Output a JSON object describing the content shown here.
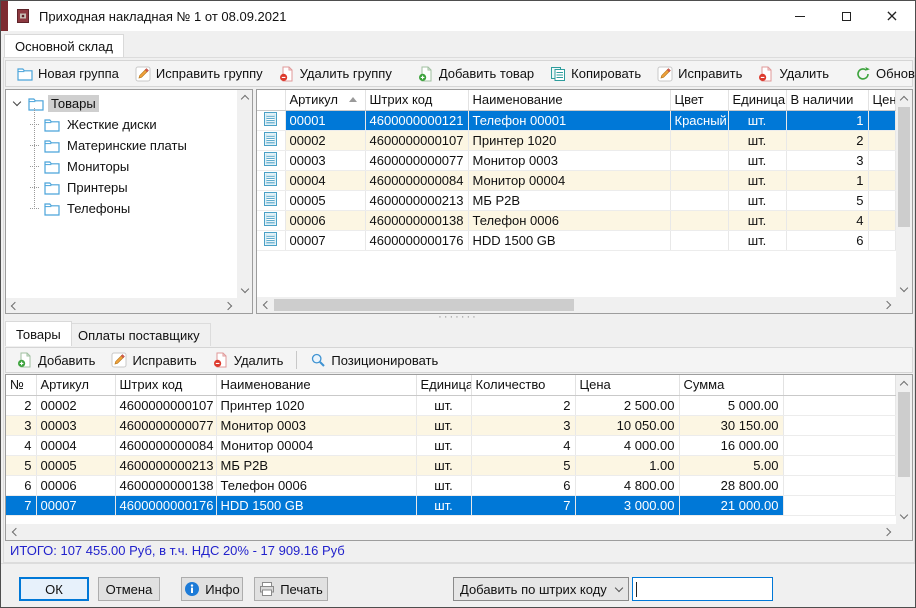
{
  "window": {
    "title": "Приходная накладная № 1 от 08.09.2021",
    "app_icon": "book-icon",
    "controls": [
      "minimize",
      "maximize",
      "close"
    ]
  },
  "main_tab": {
    "label": "Основной склад"
  },
  "toolbar_top": {
    "buttons": [
      {
        "icon": "new-group-folder-icon",
        "label": "Новая группа"
      },
      {
        "icon": "edit-pencil-icon",
        "label": "Исправить группу"
      },
      {
        "icon": "delete-page-icon",
        "label": "Удалить группу"
      },
      {
        "icon": "add-page-icon",
        "label": "Добавить товар"
      },
      {
        "icon": "copy-pages-icon",
        "label": "Копировать"
      },
      {
        "icon": "edit-pencil-icon",
        "label": "Исправить"
      },
      {
        "icon": "delete-page-icon",
        "label": "Удалить"
      },
      {
        "icon": "refresh-icon",
        "label": "Обновить"
      }
    ]
  },
  "tree": {
    "root": "Товары",
    "children": [
      "Жесткие диски",
      "Материнские платы",
      "Мониторы",
      "Принтеры",
      "Телефоны"
    ]
  },
  "products_table": {
    "columns": [
      "",
      "Артикул",
      "Штрих код",
      "Наименование",
      "Цвет",
      "Единица",
      "В наличии",
      "Цена"
    ],
    "sort": {
      "column": "Артикул",
      "direction": "asc"
    },
    "rows": [
      {
        "articul": "00001",
        "barcode": "4600000000121",
        "name": "Телефон 00001",
        "color": "Красный",
        "unit": "шт.",
        "stock": "1",
        "price": "",
        "selected": true
      },
      {
        "articul": "00002",
        "barcode": "4600000000107",
        "name": "Принтер 1020",
        "color": "",
        "unit": "шт.",
        "stock": "2",
        "price": ""
      },
      {
        "articul": "00003",
        "barcode": "4600000000077",
        "name": "Монитор 0003",
        "color": "",
        "unit": "шт.",
        "stock": "3",
        "price": ""
      },
      {
        "articul": "00004",
        "barcode": "4600000000084",
        "name": "Монитор 00004",
        "color": "",
        "unit": "шт.",
        "stock": "1",
        "price": ""
      },
      {
        "articul": "00005",
        "barcode": "4600000000213",
        "name": "МБ Р2В",
        "color": "",
        "unit": "шт.",
        "stock": "5",
        "price": ""
      },
      {
        "articul": "00006",
        "barcode": "4600000000138",
        "name": "Телефон 0006",
        "color": "",
        "unit": "шт.",
        "stock": "4",
        "price": ""
      },
      {
        "articul": "00007",
        "barcode": "4600000000176",
        "name": "HDD 1500 GB",
        "color": "",
        "unit": "шт.",
        "stock": "6",
        "price": ""
      }
    ]
  },
  "bottom_tabs": [
    {
      "label": "Товары",
      "active": true
    },
    {
      "label": "Оплаты поставщику",
      "active": false
    }
  ],
  "toolbar_bottom": {
    "buttons": [
      {
        "icon": "add-page-icon",
        "label": "Добавить"
      },
      {
        "icon": "edit-pencil-icon",
        "label": "Исправить"
      },
      {
        "icon": "delete-page-icon",
        "label": "Удалить"
      },
      {
        "icon": "search-icon",
        "label": "Позиционировать"
      }
    ]
  },
  "invoice_table": {
    "columns": [
      "№",
      "Артикул",
      "Штрих код",
      "Наименование",
      "Единица",
      "Количество",
      "Цена",
      "Сумма"
    ],
    "rows": [
      {
        "num": "2",
        "articul": "00002",
        "barcode": "4600000000107",
        "name": "Принтер 1020",
        "unit": "шт.",
        "qty": "2",
        "price": "2 500.00",
        "sum": "5 000.00"
      },
      {
        "num": "3",
        "articul": "00003",
        "barcode": "4600000000077",
        "name": "Монитор 0003",
        "unit": "шт.",
        "qty": "3",
        "price": "10 050.00",
        "sum": "30 150.00"
      },
      {
        "num": "4",
        "articul": "00004",
        "barcode": "4600000000084",
        "name": "Монитор 00004",
        "unit": "шт.",
        "qty": "4",
        "price": "4 000.00",
        "sum": "16 000.00"
      },
      {
        "num": "5",
        "articul": "00005",
        "barcode": "4600000000213",
        "name": "МБ Р2В",
        "unit": "шт.",
        "qty": "5",
        "price": "1.00",
        "sum": "5.00"
      },
      {
        "num": "6",
        "articul": "00006",
        "barcode": "4600000000138",
        "name": "Телефон 0006",
        "unit": "шт.",
        "qty": "6",
        "price": "4 800.00",
        "sum": "28 800.00"
      },
      {
        "num": "7",
        "articul": "00007",
        "barcode": "4600000000176",
        "name": "HDD 1500 GB",
        "unit": "шт.",
        "qty": "7",
        "price": "3 000.00",
        "sum": "21 000.00",
        "selected": true
      }
    ]
  },
  "totals": {
    "text": "ИТОГО: 107 455.00 Руб, в т.ч. НДС 20% - 17 909.16 Руб"
  },
  "footer": {
    "ok": "ОК",
    "cancel": "Отмена",
    "info": "Инфо",
    "print": "Печать",
    "combo_value": "Добавить по штрих коду",
    "barcode_input": {
      "value": "",
      "placeholder": ""
    }
  },
  "colors": {
    "selection_bg": "#0078d7",
    "alt_row_bg": "#fcf6e3",
    "status_text": "#2222cc",
    "default_button_border": "#0078d7",
    "title_icon": "#7d2b31"
  },
  "icons": {
    "book-icon": "maroon book",
    "new-group-folder-icon": "blue outline folder",
    "edit-pencil-icon": "orange pencil on page",
    "delete-page-icon": "page with red minus badge",
    "add-page-icon": "page with green plus badge",
    "copy-pages-icon": "two teal pages",
    "refresh-icon": "green circular arrow",
    "search-icon": "blue magnifier",
    "info-icon": "blue circle with i",
    "print-icon": "gray printer",
    "row-doc-icon": "teal lined document",
    "sort-ascending-icon": "up triangle"
  }
}
